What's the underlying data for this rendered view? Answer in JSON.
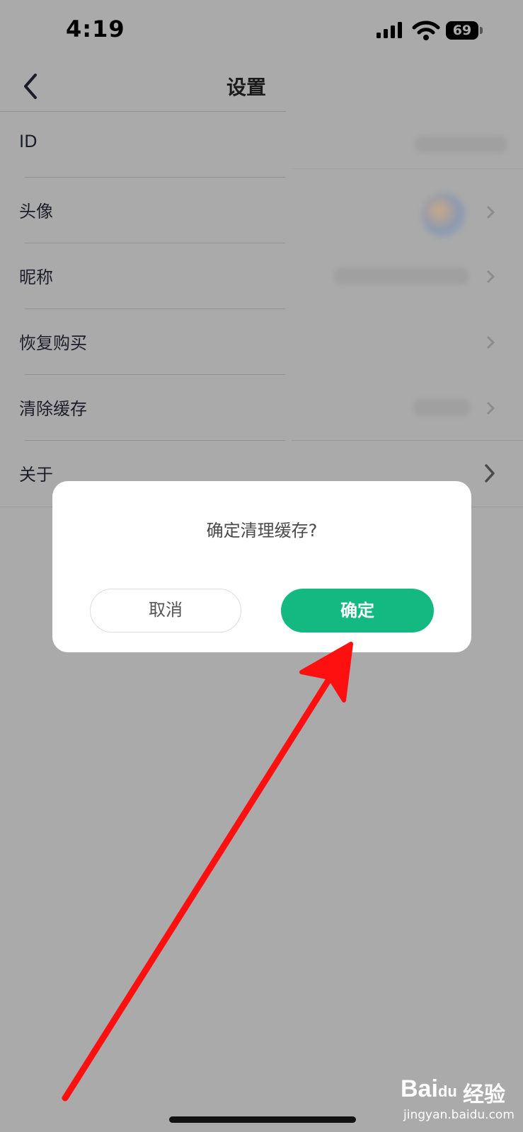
{
  "status_bar": {
    "time": "4:19",
    "battery_level": "69"
  },
  "nav": {
    "title": "设置"
  },
  "settings": {
    "items": [
      {
        "label": "ID"
      },
      {
        "label": "头像"
      },
      {
        "label": "昵称"
      },
      {
        "label": "恢复购买"
      },
      {
        "label": "清除缓存"
      },
      {
        "label": "关于"
      }
    ]
  },
  "dialog": {
    "message": "确定清理缓存?",
    "cancel_label": "取消",
    "confirm_label": "确定"
  },
  "watermark": {
    "brand": "Bai",
    "brand_suffix": "du",
    "product": "经验",
    "url": "jingyan.baidu.com"
  },
  "colors": {
    "accent": "#13b981",
    "overlay": "#aaaaaa",
    "annotation_arrow": "#ff0000"
  }
}
